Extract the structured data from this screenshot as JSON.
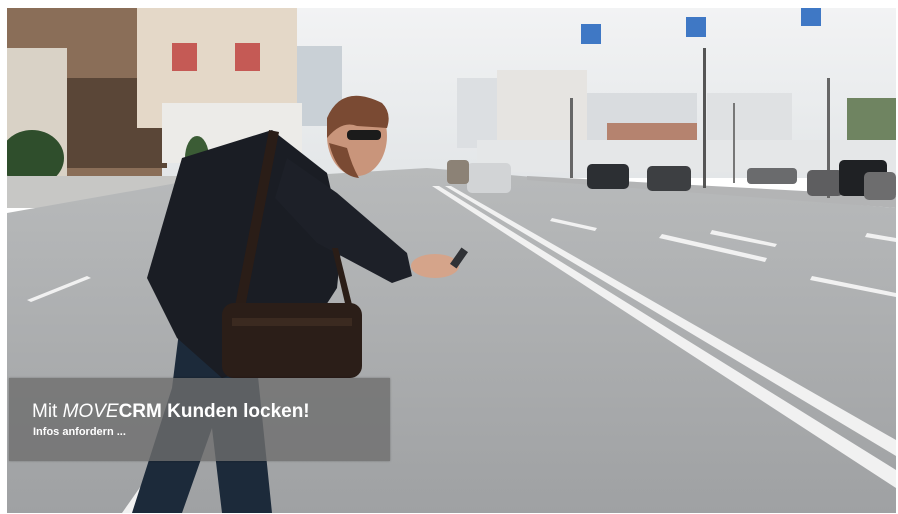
{
  "banner": {
    "caption": {
      "prefix": "Mit ",
      "brand_italic": "MOVE",
      "brand_bold": "CRM",
      "suffix": " Kunden locken!",
      "link": "Infos anfordern ..."
    },
    "colors": {
      "sky": "#e9ecee",
      "road": "#a9abad",
      "overlay": "#6e6e6e",
      "text": "#ffffff"
    },
    "icons": [
      "road-sign-icon"
    ]
  }
}
